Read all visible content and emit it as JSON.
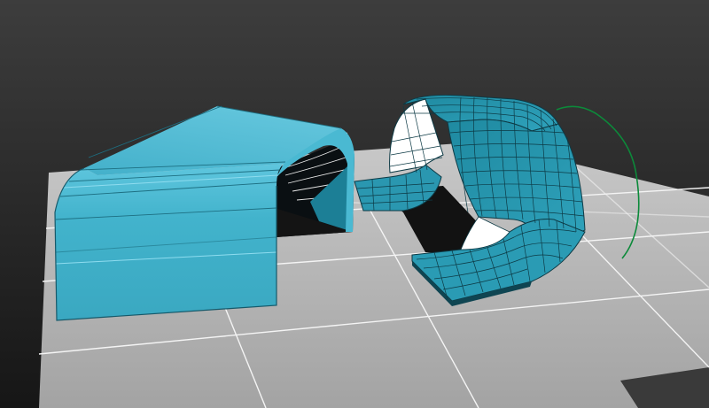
{
  "viewport": {
    "mode": "perspective",
    "shading": "edged-faces"
  },
  "colors": {
    "bg_top": "#3c3c3c",
    "bg_bottom": "#1a1a1a",
    "ground": "#b5b5b5",
    "grid_line": "#f2f2f2",
    "object_fill": "#3fb4cd",
    "object_fill_light": "#5cc4dc",
    "object_fill_dark": "#1f7f94",
    "object_dark_interior": "#0c3f4b",
    "wire": "#0f3944",
    "spline": "#0c8a3a"
  },
  "objects": [
    {
      "id": "shell-left",
      "type": "extruded-arch"
    },
    {
      "id": "shell-right",
      "type": "twisted-arch",
      "wireframe": true
    },
    {
      "id": "path-spline",
      "type": "spline"
    }
  ]
}
